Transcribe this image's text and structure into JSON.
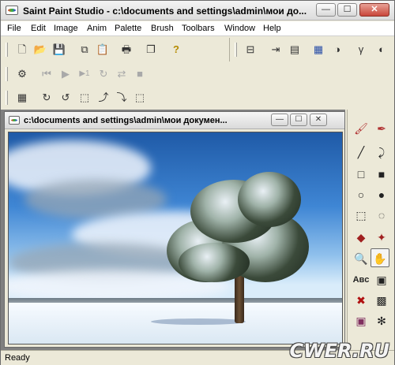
{
  "window": {
    "title": "Saint Paint Studio - c:\\documents and settings\\admin\\мои до...",
    "minimize": "—",
    "maximize": "☐",
    "close": "✕"
  },
  "menu": [
    "File",
    "Edit",
    "Image",
    "Anim",
    "Palette",
    "Brush",
    "Toolbars",
    "Window",
    "Help"
  ],
  "toolbar": {
    "standard_icons": [
      "new-file-icon",
      "open-folder-icon",
      "save-icon",
      "copy-icon",
      "paste-icon",
      "print-icon",
      "window-icon",
      "help-icon"
    ],
    "standard_glyphs": [
      "🗋",
      "📂",
      "💾",
      "⧉",
      "📋",
      "🖶",
      "❐",
      "?"
    ],
    "right_glyphs": [
      "⊟",
      "⇥",
      "▤",
      "▦",
      "◑",
      "γ",
      "◐"
    ],
    "anim_glyphs": [
      "⚙",
      "⏮",
      "▶",
      "▶1",
      "↻",
      "⇄",
      "■"
    ],
    "transform_glyphs": [
      "▦",
      "↻",
      "↺",
      "⬚",
      "⤴",
      "⤵",
      "⬚"
    ]
  },
  "child_window": {
    "title": "c:\\documents and settings\\admin\\мои докумен...",
    "minimize": "—",
    "maximize": "☐",
    "close": "✕"
  },
  "tools": [
    {
      "name": "brush-icon",
      "glyph": "🖌"
    },
    {
      "name": "eyedropper-icon",
      "glyph": "✒"
    },
    {
      "name": "line-icon",
      "glyph": "╱"
    },
    {
      "name": "curve-icon",
      "glyph": "⤸"
    },
    {
      "name": "rectangle-icon",
      "glyph": "□"
    },
    {
      "name": "filled-rectangle-icon",
      "glyph": "■"
    },
    {
      "name": "ellipse-icon",
      "glyph": "○"
    },
    {
      "name": "filled-ellipse-icon",
      "glyph": "●"
    },
    {
      "name": "rect-select-icon",
      "glyph": "⬚"
    },
    {
      "name": "lasso-select-icon",
      "glyph": "◌"
    },
    {
      "name": "fill-bucket-icon",
      "glyph": "◆"
    },
    {
      "name": "spray-icon",
      "glyph": "✦"
    },
    {
      "name": "zoom-icon",
      "glyph": "🔍"
    },
    {
      "name": "hand-icon",
      "glyph": "✋"
    },
    {
      "name": "text-icon",
      "glyph": "A"
    },
    {
      "name": "image-tool-icon",
      "glyph": "▣"
    },
    {
      "name": "clone-icon",
      "glyph": "✖"
    },
    {
      "name": "pattern-icon",
      "glyph": "▩"
    },
    {
      "name": "stamp-icon",
      "glyph": "▣"
    },
    {
      "name": "effect-icon",
      "glyph": "✻"
    }
  ],
  "text_tool_label": "Aʙᴄ",
  "status": "Ready",
  "watermark": "CWER.RU"
}
